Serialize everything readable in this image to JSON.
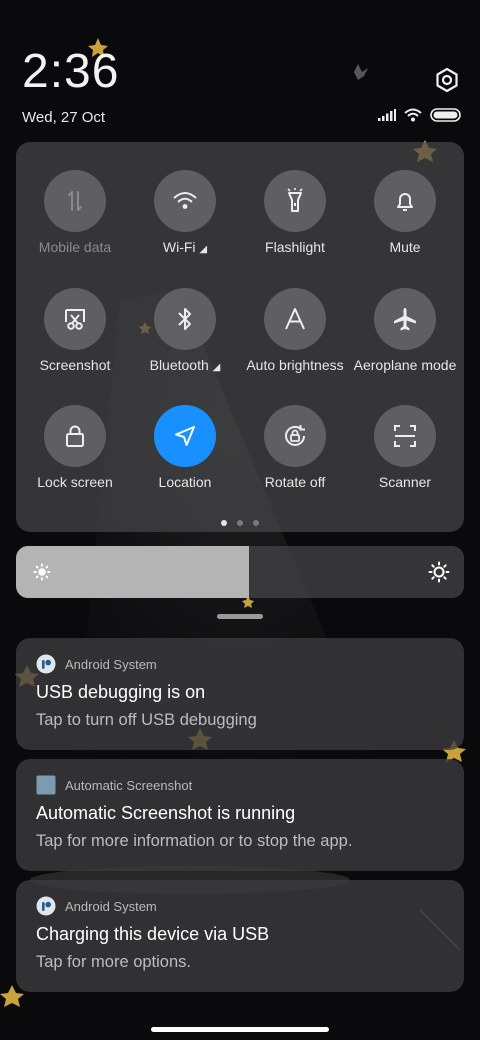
{
  "status": {
    "time": "2:36",
    "date": "Wed, 27 Oct"
  },
  "quick_settings": [
    {
      "label": "Mobile data",
      "icon": "mobile-data-icon",
      "state": "unavailable"
    },
    {
      "label": "Wi-Fi",
      "icon": "wifi-icon",
      "state": "on"
    },
    {
      "label": "Flashlight",
      "icon": "flashlight-icon",
      "state": "off"
    },
    {
      "label": "Mute",
      "icon": "bell-icon",
      "state": "off"
    },
    {
      "label": "Screenshot",
      "icon": "scissors-icon",
      "state": "off"
    },
    {
      "label": "Bluetooth",
      "icon": "bluetooth-icon",
      "state": "off"
    },
    {
      "label": "Auto brightness",
      "icon": "auto-brightness-icon",
      "state": "off"
    },
    {
      "label": "Aeroplane mode",
      "icon": "airplane-icon",
      "state": "off"
    },
    {
      "label": "Lock screen",
      "icon": "lock-icon",
      "state": "off"
    },
    {
      "label": "Location",
      "icon": "location-arrow-icon",
      "state": "on"
    },
    {
      "label": "Rotate off",
      "icon": "rotate-lock-icon",
      "state": "off"
    },
    {
      "label": "Scanner",
      "icon": "scanner-icon",
      "state": "off"
    }
  ],
  "pager": {
    "pages": 3,
    "current": 1
  },
  "brightness": {
    "level": 0.52
  },
  "notifications": [
    {
      "app": "Android System",
      "title": "USB debugging is on",
      "body": "Tap to turn off USB debugging"
    },
    {
      "app": "Automatic Screenshot",
      "title": "Automatic Screenshot is running",
      "body": "Tap for more information or to stop the app."
    },
    {
      "app": "Android System",
      "title": "Charging this device via USB",
      "body": "Tap for more options."
    }
  ],
  "colors": {
    "accent": "#1890ff",
    "panel": "#46464a",
    "background": "#0a0a0c"
  }
}
